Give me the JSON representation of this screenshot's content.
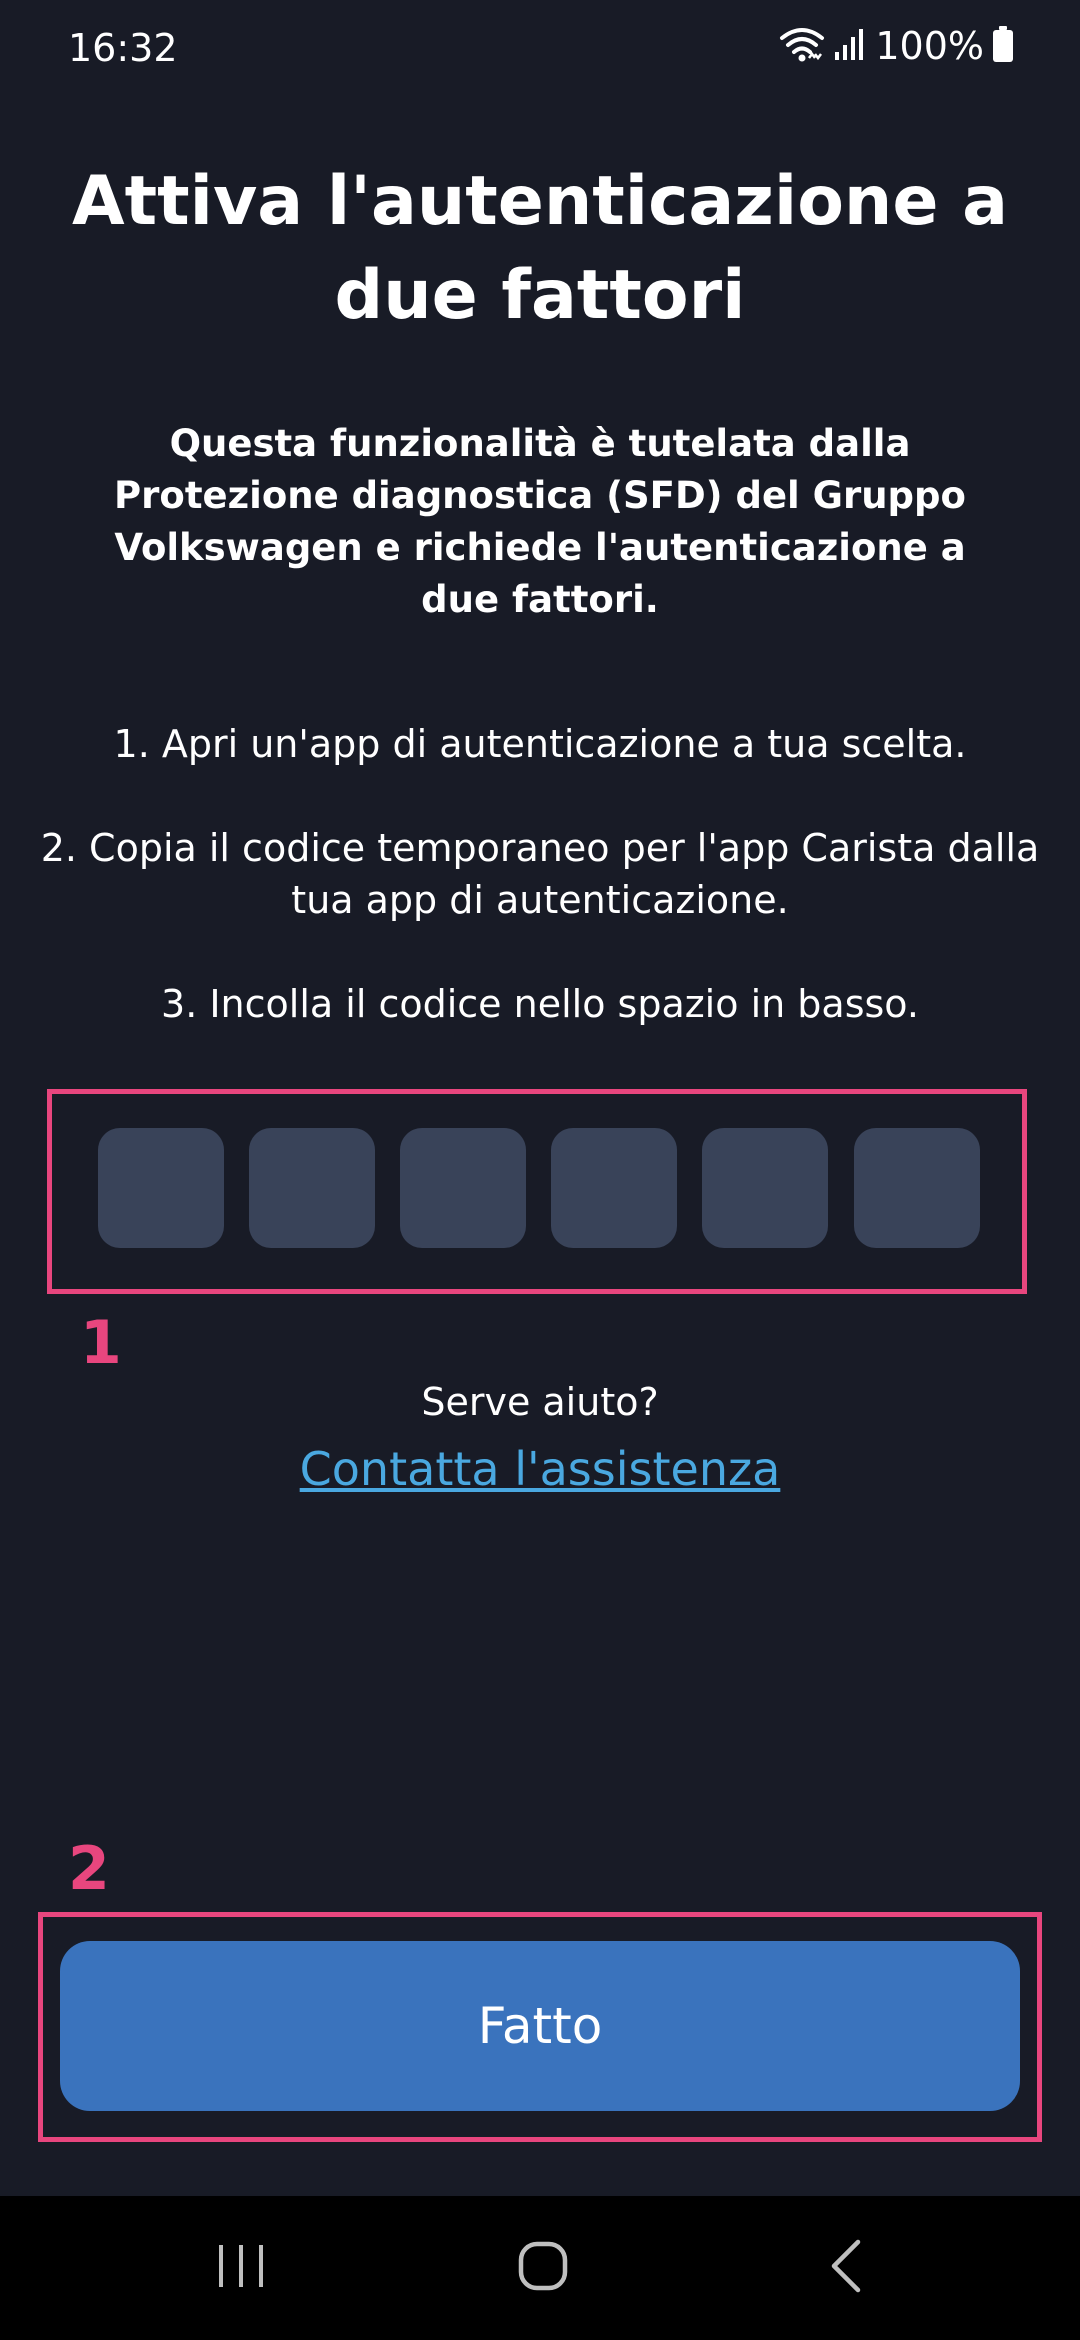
{
  "status_bar": {
    "time": "16:32",
    "battery": "100%",
    "icons": [
      "wifi-icon",
      "signal-icon",
      "battery-icon"
    ]
  },
  "title": "Attiva l'autenticazione a due fattori",
  "subtitle": "Questa funzionalità è tutelata dalla Protezione diagnostica (SFD) del Gruppo Volkswagen e richiede l'autenticazione a due fattori.",
  "steps": [
    "1. Apri un'app di autenticazione a tua scelta.",
    "2. Copia il codice temporaneo per l'app Carista dalla tua app di autenticazione.",
    "3. Incolla il codice nello spazio in basso."
  ],
  "code_input": {
    "digits": [
      "",
      "",
      "",
      "",
      "",
      ""
    ]
  },
  "annotations": {
    "first": "1",
    "second": "2"
  },
  "help": {
    "question": "Serve aiuto?",
    "link": "Contatta l'assistenza"
  },
  "done_button": "Fatto",
  "colors": {
    "background": "#181b26",
    "cell": "#394359",
    "accent": "#3a73bd",
    "link": "#4aa8e0",
    "annotation": "#e8467e"
  },
  "nav_bar": {
    "icons": [
      "recent-apps-icon",
      "home-icon",
      "back-icon"
    ]
  }
}
